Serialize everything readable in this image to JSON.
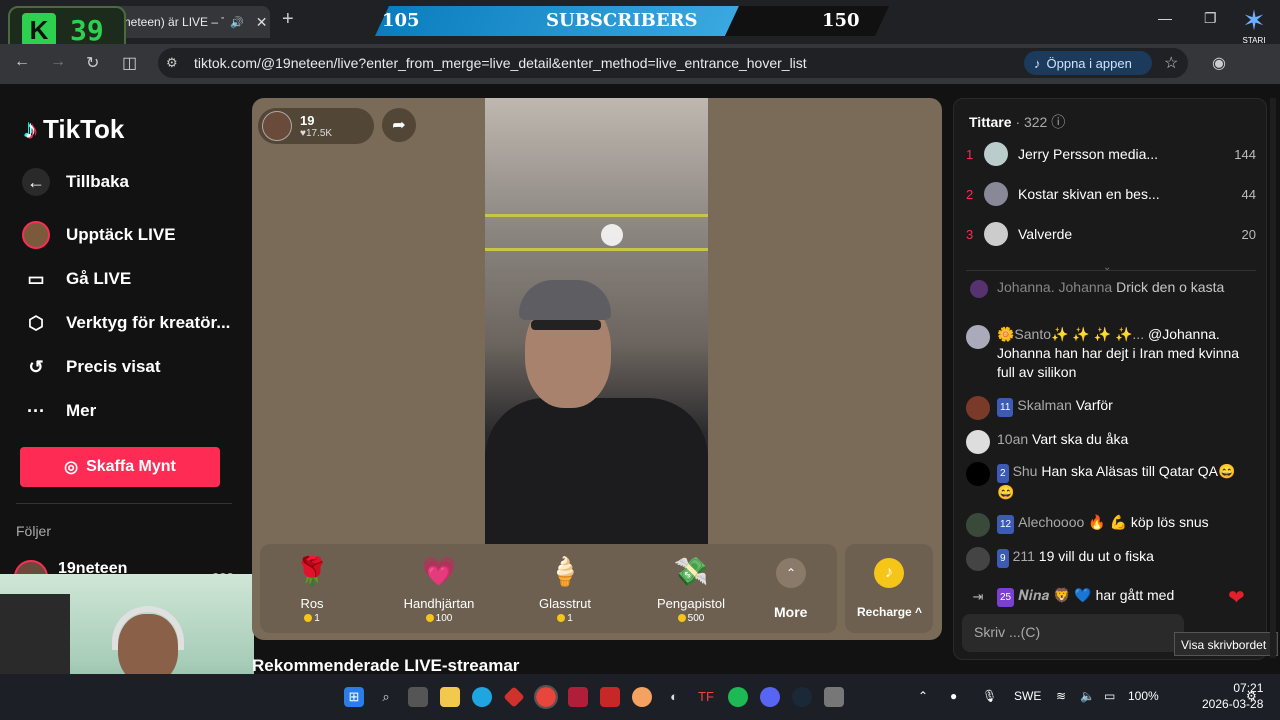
{
  "browser": {
    "tab_title": "neteen) är LIVE – Ti",
    "new_tab": "+",
    "url": "tiktok.com/@19neteen/live?enter_from_merge=live_detail&enter_method=live_entrance_hover_list",
    "open_app": "Öppna i appen"
  },
  "overlay": {
    "k_letter": "K",
    "k_count": "39",
    "sub_left": "105",
    "sub_label": "SUBSCRIBERS",
    "sub_right": "150",
    "stari_label": "STARI"
  },
  "sidebar": {
    "brand": "TikTok",
    "back": "Tillbaka",
    "items": [
      {
        "label": "Upptäck LIVE",
        "icon": "live-avatar-icon"
      },
      {
        "label": "Gå LIVE",
        "icon": "camera-icon"
      },
      {
        "label": "Verktyg för kreatör...",
        "icon": "creator-tools-icon"
      },
      {
        "label": "Precis visat",
        "icon": "history-icon"
      },
      {
        "label": "Mer",
        "icon": "more-dots-icon"
      }
    ],
    "coins_button": "Skaffa Mynt",
    "following_title": "Följer",
    "following": [
      {
        "name": "19neteen",
        "count": "322"
      }
    ]
  },
  "stream": {
    "host_name": "19",
    "host_likes": "17.5K",
    "gifts": [
      {
        "name": "Ros",
        "price": "1",
        "icon": "rose-icon",
        "glyph": "🌹"
      },
      {
        "name": "Handhjärtan",
        "price": "100",
        "icon": "heart-hands-icon",
        "glyph": "💗"
      },
      {
        "name": "Glasstrut",
        "price": "1",
        "icon": "ice-cream-icon",
        "glyph": "🍦"
      },
      {
        "name": "Pengapistol",
        "price": "500",
        "icon": "money-gun-icon",
        "glyph": "💸"
      }
    ],
    "more": "More",
    "recharge": "Recharge ^",
    "recommended": "Rekommenderade LIVE-streamar"
  },
  "chat": {
    "viewers_label": "Tittare",
    "viewers_count": "· 322",
    "top": [
      {
        "rank": "1",
        "name": "Jerry Persson media...",
        "value": "144"
      },
      {
        "rank": "2",
        "name": "Kostar skivan en bes...",
        "value": "44"
      },
      {
        "rank": "3",
        "name": "Valverde",
        "value": "20"
      }
    ],
    "messages": [
      {
        "user": "Johanna. Johanna",
        "level": "",
        "text": "Drick den o kasta"
      },
      {
        "user": "🌼Santo✨ ✨ ✨ ✨...",
        "level": "",
        "text": "@Johanna. Johanna han har dejt i Iran med kvinna full av silikon"
      },
      {
        "user": "Skalman",
        "level": "11",
        "text": "Varför"
      },
      {
        "user": "10an",
        "level": "",
        "text": "Vart ska du åka"
      },
      {
        "user": "Shu",
        "level": "2",
        "text": "Han ska Aläsas till Qatar QA😄 😄"
      },
      {
        "user": "Alechoooo 🔥 💪",
        "level": "12",
        "text": "köp lös snus"
      },
      {
        "user": "211",
        "level": "9",
        "text": "19 vill du ut o fiska"
      },
      {
        "user": "𝑵𝒊𝒏𝒂 🦁 💙",
        "level": "25",
        "text": "har gått med"
      }
    ],
    "input_placeholder": "Skriv ...(C)",
    "tooltip": "Visa skrivbordet"
  },
  "taskbar": {
    "lang": "SWE",
    "battery": "100%",
    "time": "07:21",
    "date": "2026-03-28"
  }
}
